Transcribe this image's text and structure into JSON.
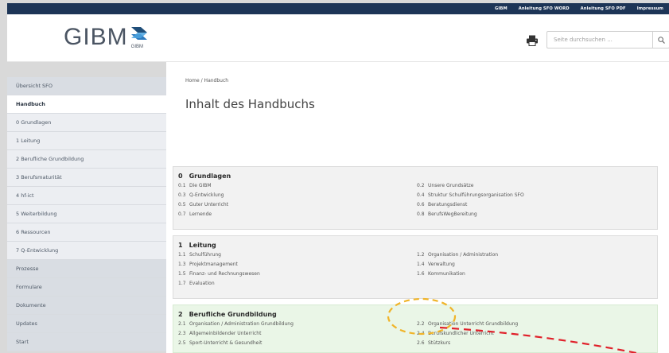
{
  "topbar": {
    "links": [
      "GIBM",
      "Anleitung SFO WORD",
      "Anleitung SFO PDF",
      "Impressum"
    ]
  },
  "header": {
    "logo_text": "GIBM",
    "logo_sub": "GIBM",
    "search_placeholder": "Seite durchsuchen ..."
  },
  "sidebar": {
    "items": [
      {
        "label": "Übersicht SFO",
        "style": "head"
      },
      {
        "label": "Handbuch",
        "style": "active"
      },
      {
        "label": "0 Grundlagen",
        "style": "light"
      },
      {
        "label": "1 Leitung",
        "style": "light"
      },
      {
        "label": "2 Berufliche Grundbildung",
        "style": "light"
      },
      {
        "label": "3 Berufsmaturität",
        "style": "light"
      },
      {
        "label": "4 hf-ict",
        "style": "light"
      },
      {
        "label": "5 Weiterbildung",
        "style": "light"
      },
      {
        "label": "6 Ressourcen",
        "style": "light"
      },
      {
        "label": "7 Q-Entwicklung",
        "style": "light"
      },
      {
        "label": "Prozesse",
        "style": "head"
      },
      {
        "label": "Formulare",
        "style": "head"
      },
      {
        "label": "Dokumente",
        "style": "head"
      },
      {
        "label": "Updates",
        "style": "head"
      },
      {
        "label": "Start",
        "style": "head"
      }
    ]
  },
  "main": {
    "breadcrumb": "Home / Handbuch",
    "title": "Inhalt des Handbuchs",
    "sections": [
      {
        "num": "0",
        "name": "Grundlagen",
        "left": [
          [
            "0.1",
            "Die GIBM"
          ],
          [
            "0.3",
            "Q-Entwicklung"
          ],
          [
            "0.5",
            "Guter Unterricht"
          ],
          [
            "0.7",
            "Lernende"
          ]
        ],
        "right": [
          [
            "0.2",
            "Unsere Grundsätze"
          ],
          [
            "0.4",
            "Struktur Schulführungsorganisation SFO"
          ],
          [
            "0.6",
            "Beratungsdienst"
          ],
          [
            "0.8",
            "BerufsWegBereitung"
          ]
        ]
      },
      {
        "num": "1",
        "name": "Leitung",
        "left": [
          [
            "1.1",
            "Schulführung"
          ],
          [
            "1.3",
            "Projektmanagement"
          ],
          [
            "1.5",
            "Finanz- und Rechnungswesen"
          ],
          [
            "1.7",
            "Evaluation"
          ]
        ],
        "right": [
          [
            "1.2",
            "Organisation / Administration"
          ],
          [
            "1.4",
            "Verwaltung"
          ],
          [
            "1.6",
            "Kommunikation"
          ]
        ]
      },
      {
        "num": "2",
        "name": "Berufliche Grundbildung",
        "left": [
          [
            "2.1",
            "Organisation / Administration Grundbildung"
          ],
          [
            "2.3",
            "Allgemeinbildender Unterricht"
          ],
          [
            "2.5",
            "Sport-Unterricht & Gesundheit"
          ]
        ],
        "right": [
          [
            "2.2",
            "Organisation Unterricht Grundbildung"
          ],
          [
            "2.4",
            "Berufskundlicher Unterricht"
          ],
          [
            "2.6",
            "Stützkurs"
          ]
        ]
      }
    ]
  },
  "colors": {
    "topbar": "#1d3557",
    "section_gray": "#f2f2f2",
    "section_green": "#eaf6e7",
    "annot_orange": "#f0b429",
    "annot_red": "#e0202a"
  },
  "icons": {
    "printer": "printer-icon",
    "search": "search-icon",
    "logo_arrows": "logo-arrows-icon"
  }
}
